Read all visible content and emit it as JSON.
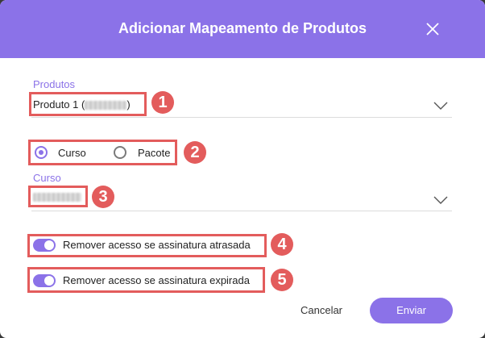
{
  "dialog": {
    "title": "Adicionar Mapeamento de Produtos",
    "close_icon": "close-icon",
    "accent_color": "#8b72e8",
    "highlight_color": "#e35c5c"
  },
  "produtos": {
    "label": "Produtos",
    "value": "Produto 1 (",
    "value_suffix": ")"
  },
  "type_selector": {
    "options": [
      "Curso",
      "Pacote"
    ],
    "selected": "Curso"
  },
  "curso": {
    "label": "Curso"
  },
  "toggles": [
    {
      "label": "Remover acesso se assinatura atrasada",
      "on": true
    },
    {
      "label": "Remover acesso se assinatura expirada",
      "on": true
    }
  ],
  "annotations": [
    "1",
    "2",
    "3",
    "4",
    "5"
  ],
  "actions": {
    "cancel_label": "Cancelar",
    "submit_label": "Enviar"
  }
}
